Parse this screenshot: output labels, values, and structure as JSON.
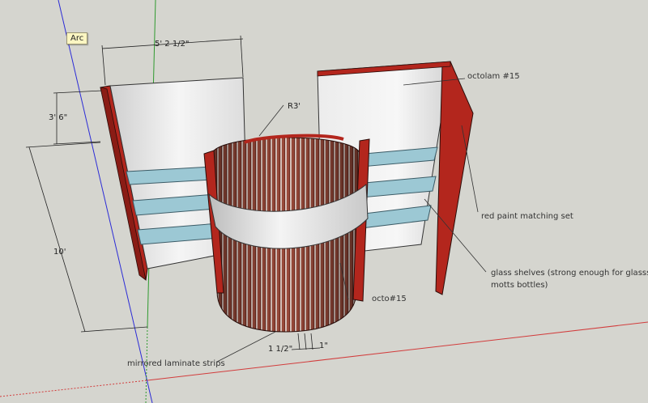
{
  "tooltip": {
    "text": "Arc"
  },
  "dimensions": {
    "width": "5' 2 1/2\"",
    "depth": "3' 6\"",
    "height": "10'",
    "radius": "R3'",
    "strip_width": "1 1/2\"",
    "strip_gap": "1\""
  },
  "annotations": {
    "octolam": "octolam #15",
    "red_paint": "red paint matching set",
    "glass_shelves": "glass shelves (strong enough for glasss motts bottles)",
    "octo": "octo#15",
    "mirrored_strips": "mirrored laminate strips"
  },
  "colors": {
    "background": "#d5d5cf",
    "red_paint": "#b3261d",
    "glass": "#9cc8d4",
    "mirror_strip": "#b06b5a",
    "panel_white": "#e8e8e8"
  }
}
